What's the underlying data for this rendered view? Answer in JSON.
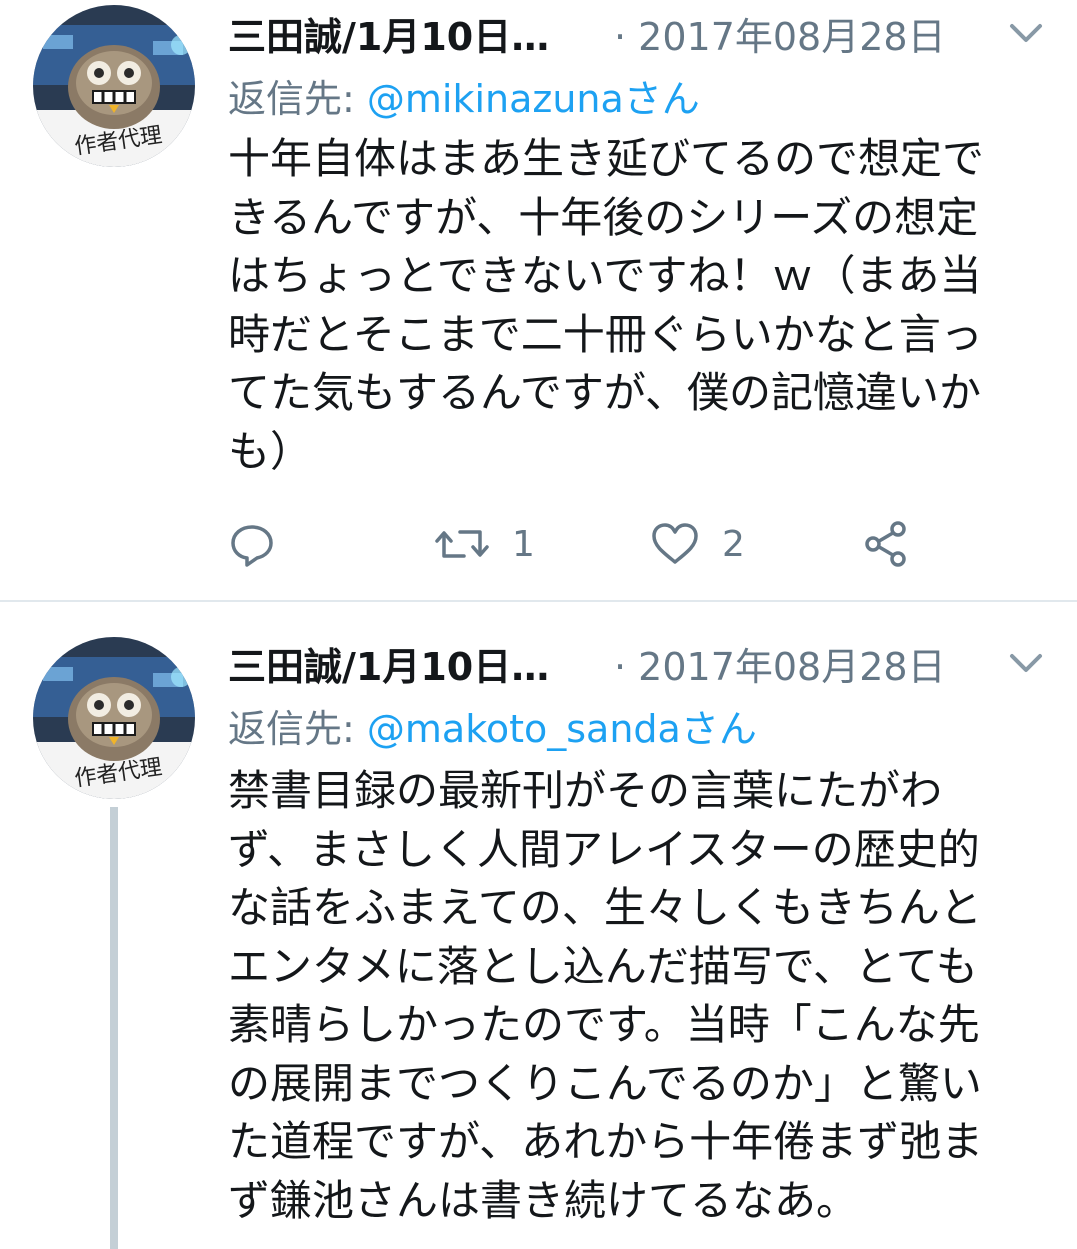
{
  "tweets": [
    {
      "author_name": "三田誠/1月10日…",
      "date_prefix": "· ",
      "date": "2017年08月28日",
      "reply_label": "返信先: ",
      "reply_handle": "@mikinazunaさん",
      "avatar_label": "作者代理",
      "text": "十年自体はまあ生き延びてるので想定で\nきるんですが、十年後のシリーズの想定\nはちょっとできないですね！ｗ（まあ当\n時だとそこまで二十冊ぐらいかなと言っ\nてた気もするんですが、僕の記憶違いか\nも）",
      "retweet_count": "1",
      "like_count": "2"
    },
    {
      "author_name": "三田誠/1月10日…",
      "date_prefix": "· ",
      "date": "2017年08月28日",
      "reply_label": "返信先: ",
      "reply_handle": "@makoto_sandaさん",
      "avatar_label": "作者代理",
      "text": "禁書目録の最新刊がその言葉にたがわ\nず、まさしく人間アレイスターの歴史的\nな話をふまえての、生々しくもきちんと\nエンタメに落とし込んだ描写で、とても\n素晴らしかったのです。当時「こんな先\nの展開までつくりこんでるのか」と驚い\nた道程ですが、あれから十年倦まず弛ま\nず鎌池さんは書き続けてるなあ。"
    }
  ],
  "colors": {
    "text": "#14171a",
    "muted": "#657786",
    "link": "#1da1f2",
    "divider": "#e1e8ed",
    "thread_line": "#c4cfd6"
  },
  "icons": [
    "reply-icon",
    "retweet-icon",
    "like-icon",
    "share-icon",
    "chevron-down-icon"
  ]
}
